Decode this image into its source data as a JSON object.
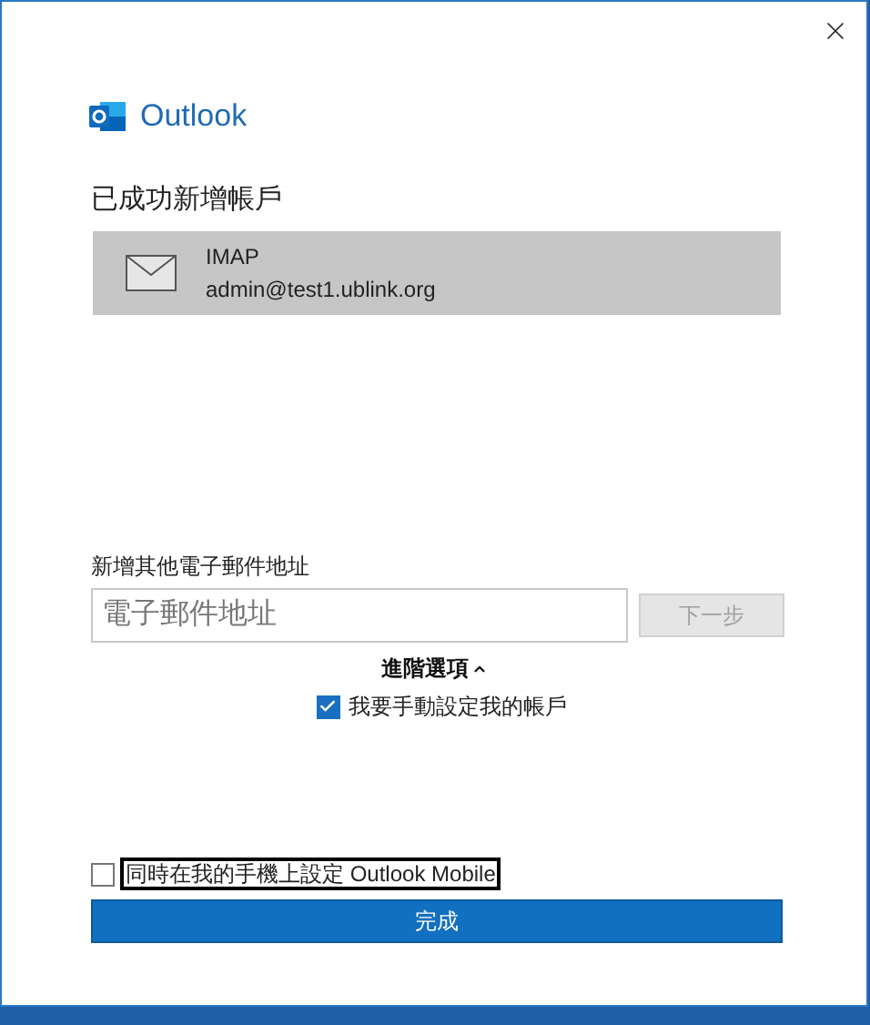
{
  "app_name": "Outlook",
  "heading": "已成功新增帳戶",
  "account": {
    "type": "IMAP",
    "email": "admin@test1.ublink.org"
  },
  "add_email": {
    "label": "新增其他電子郵件地址",
    "placeholder": "電子郵件地址",
    "next_button": {
      "label": "下一步",
      "disabled": true
    }
  },
  "advanced": {
    "label": "進階選項",
    "expanded": true
  },
  "manual_setup": {
    "label": "我要手動設定我的帳戶",
    "checked": true
  },
  "mobile_setup": {
    "label": "同時在我的手機上設定 Outlook Mobile",
    "checked": false,
    "focused": true
  },
  "finish_button": "完成"
}
